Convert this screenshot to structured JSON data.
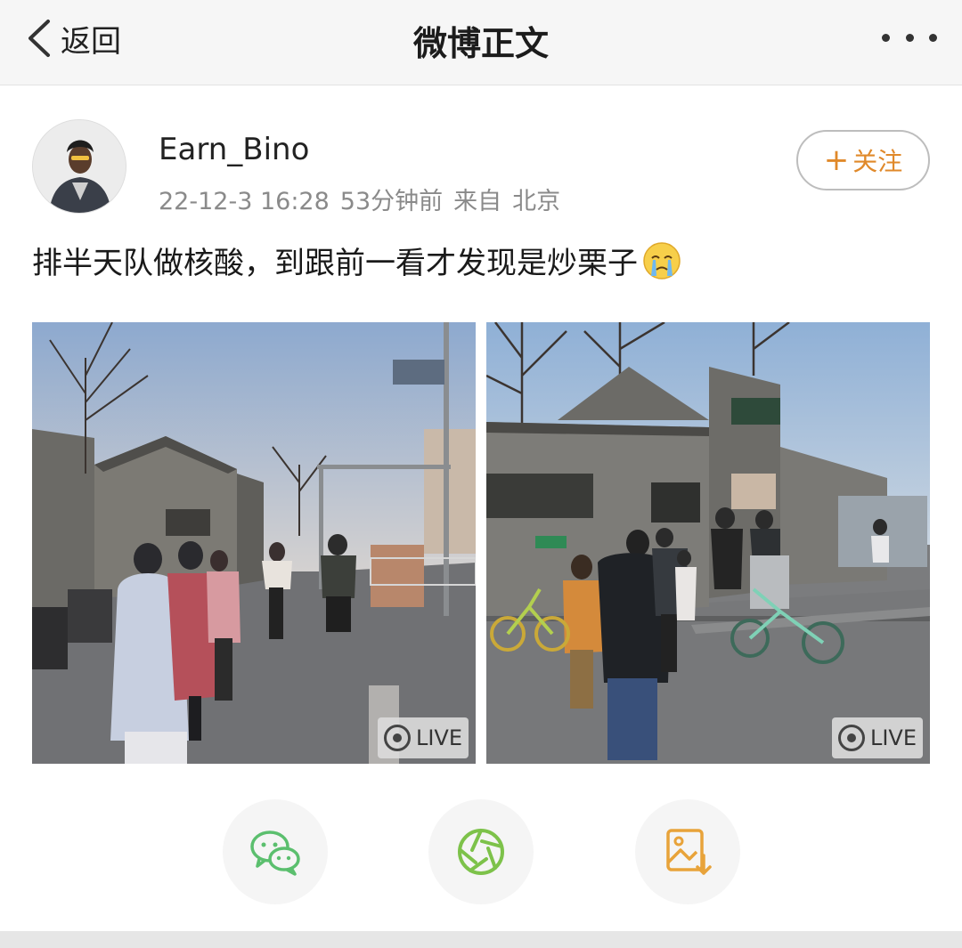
{
  "nav": {
    "back_label": "返回",
    "title": "微博正文",
    "more_icon": "more-dots-icon"
  },
  "post": {
    "author": "Earn_Bino",
    "date": "22-12-3 16:28",
    "relative_time": "53分钟前",
    "source_prefix": "来自",
    "location": "北京",
    "follow_label": "关注",
    "text": "排半天队做核酸，到跟前一看才发现是炒栗子",
    "emoji": "crying-face-emoji"
  },
  "photos": [
    {
      "badge": "LIVE"
    },
    {
      "badge": "LIVE"
    }
  ],
  "share": {
    "wechat_icon": "wechat-icon",
    "moments_icon": "wechat-moments-icon",
    "save_icon": "save-image-icon"
  },
  "colors": {
    "accent": "#e0892a",
    "wechat_green": "#5bbf6e",
    "moments_green": "#7dc24a",
    "save_orange": "#e8a33a"
  }
}
